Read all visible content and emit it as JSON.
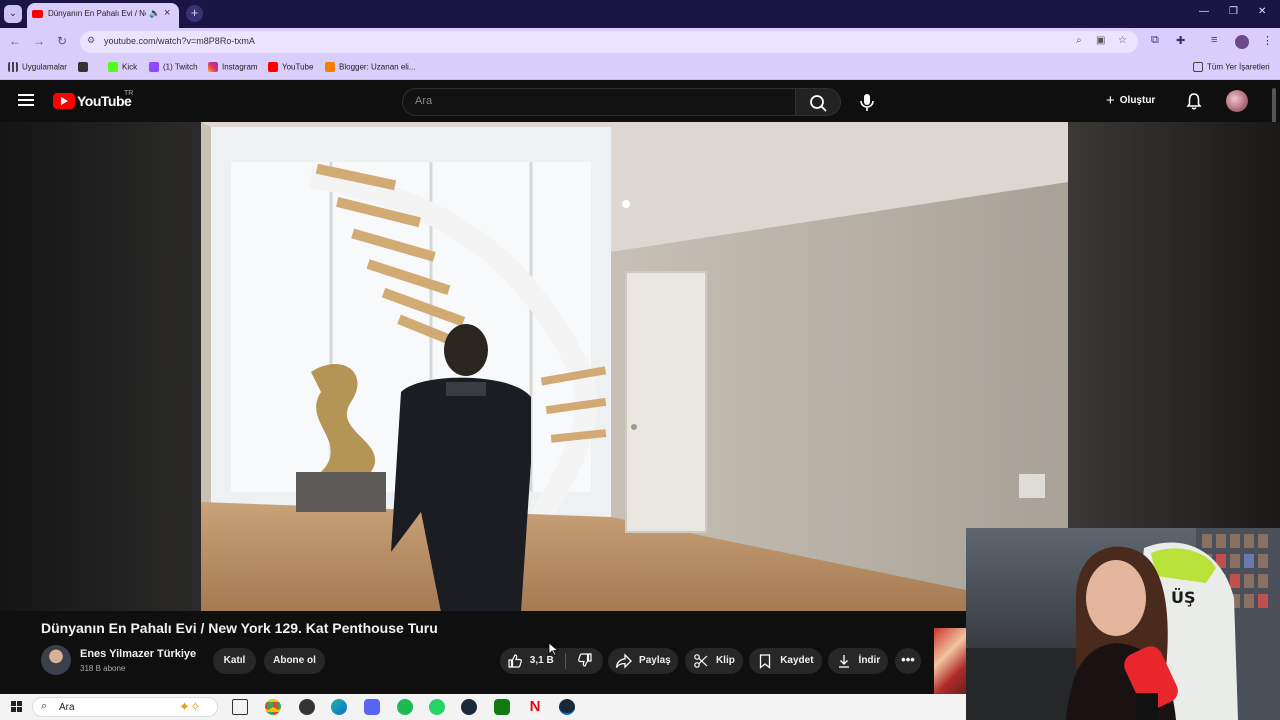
{
  "browser": {
    "tab_title": "Dünyanın En Pahalı Evi / Ne",
    "url": "youtube.com/watch?v=m8P8Ro-txmA",
    "bookmarks": [
      "Uygulamalar",
      "Kick",
      "(1) Twitch",
      "Instagram",
      "YouTube",
      "Blogger: Uzanan eli..."
    ],
    "all_bookmarks": "Tüm Yer İşaretleri"
  },
  "youtube": {
    "logo_text": "YouTube",
    "country": "TR",
    "search_placeholder": "Ara",
    "create_label": "Oluştur"
  },
  "video": {
    "title": "Dünyanın En Pahalı Evi / New York 129. Kat Penthouse Turu",
    "channel_name": "Enes Yilmazer Türkiye",
    "subscribers": "318 B abone",
    "join_label": "Katıl",
    "subscribe_label": "Abone ol",
    "like_count": "3,1 B",
    "share_label": "Paylaş",
    "clip_label": "Klip",
    "save_label": "Kaydet",
    "download_label": "İndir"
  },
  "webcam": {
    "sign_text": "ÜŞ"
  },
  "taskbar": {
    "search_text": "Ara",
    "apps": [
      "task-view",
      "chrome",
      "app",
      "edge",
      "discord",
      "spotify",
      "whatsapp",
      "steam",
      "xbox",
      "netflix",
      "steam"
    ]
  },
  "colors": {
    "chrome_frame": "#1b1545",
    "chrome_toolbar": "#d9cdfb",
    "yt_background": "#0f0f0f",
    "yt_red": "#ff0000",
    "pill": "#272727"
  }
}
